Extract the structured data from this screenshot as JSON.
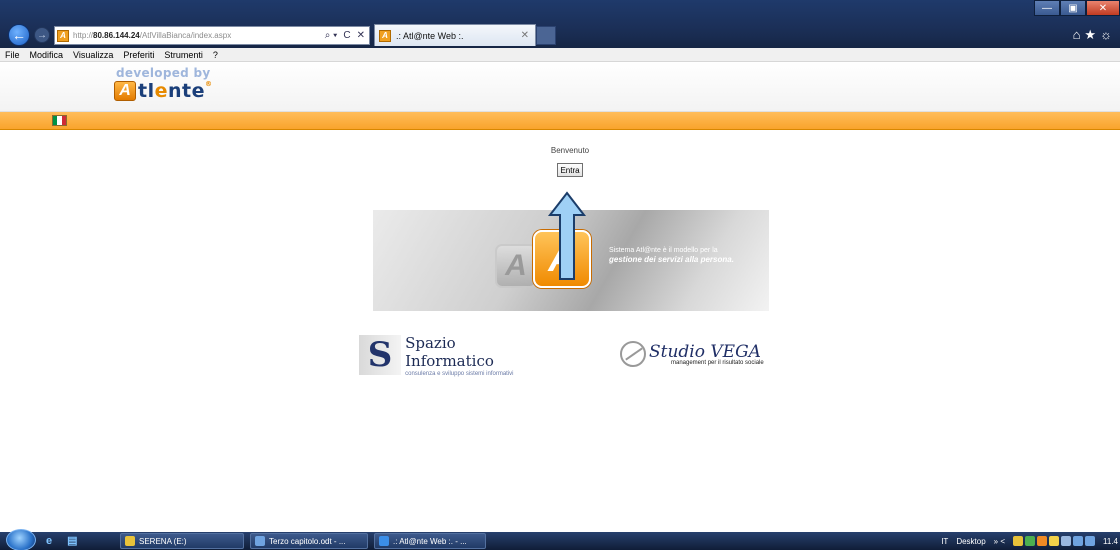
{
  "browser": {
    "url_prefix": "http://",
    "url_host": "80.86.144.24",
    "url_path": "/AtlVillaBianca/index.aspx",
    "address_tools": [
      "⌕ ▾",
      "C",
      "✕"
    ],
    "tab_title": ".: Atl@nte Web :.",
    "favicon_letter": "A",
    "window_controls": [
      "—",
      "▣",
      "✕"
    ],
    "right_icons": "⌂★☼",
    "menu": [
      "File",
      "Modifica",
      "Visualizza",
      "Preferiti",
      "Strumenti",
      "?"
    ]
  },
  "header": {
    "developed_by": "developed by",
    "logo_letter": "A",
    "logo_text_1": "tl",
    "logo_text_o": "e",
    "logo_text_2": "nte",
    "logo_reg": "®"
  },
  "language": {
    "flag_colors": [
      "#009246",
      "#ffffff",
      "#ce2b37"
    ]
  },
  "main": {
    "welcome": "Benvenuto",
    "enter_button": "Entra",
    "banner": {
      "back_letter": "A",
      "front_letter": "A",
      "line1": "Sistema Atl@nte è il modello per la",
      "line2": "gestione dei servizi alla persona."
    }
  },
  "partners": {
    "spazio": {
      "mark": "S",
      "name": "Spazio Informatico",
      "tagline": "consulenza e sviluppo sistemi informativi"
    },
    "vega": {
      "name": "Studio VEGA",
      "tagline": "management per il risultato sociale"
    }
  },
  "taskbar": {
    "quick_launch": "e ▤",
    "tasks": [
      {
        "label": "SERENA (E:)",
        "color": "#e8c23a"
      },
      {
        "label": "Terzo capitolo.odt - ...",
        "color": "#6fa3e0"
      },
      {
        "label": ".: Atl@nte Web :. - ...",
        "color": "#3b8ee8"
      }
    ],
    "lang": "IT",
    "desktop": "Desktop",
    "chevrons": "»  <",
    "clock": "11.4"
  },
  "colors": {
    "accent_orange": "#f9a42c",
    "arrow_fill": "#9fd0f5",
    "arrow_stroke": "#1b3d6a"
  }
}
